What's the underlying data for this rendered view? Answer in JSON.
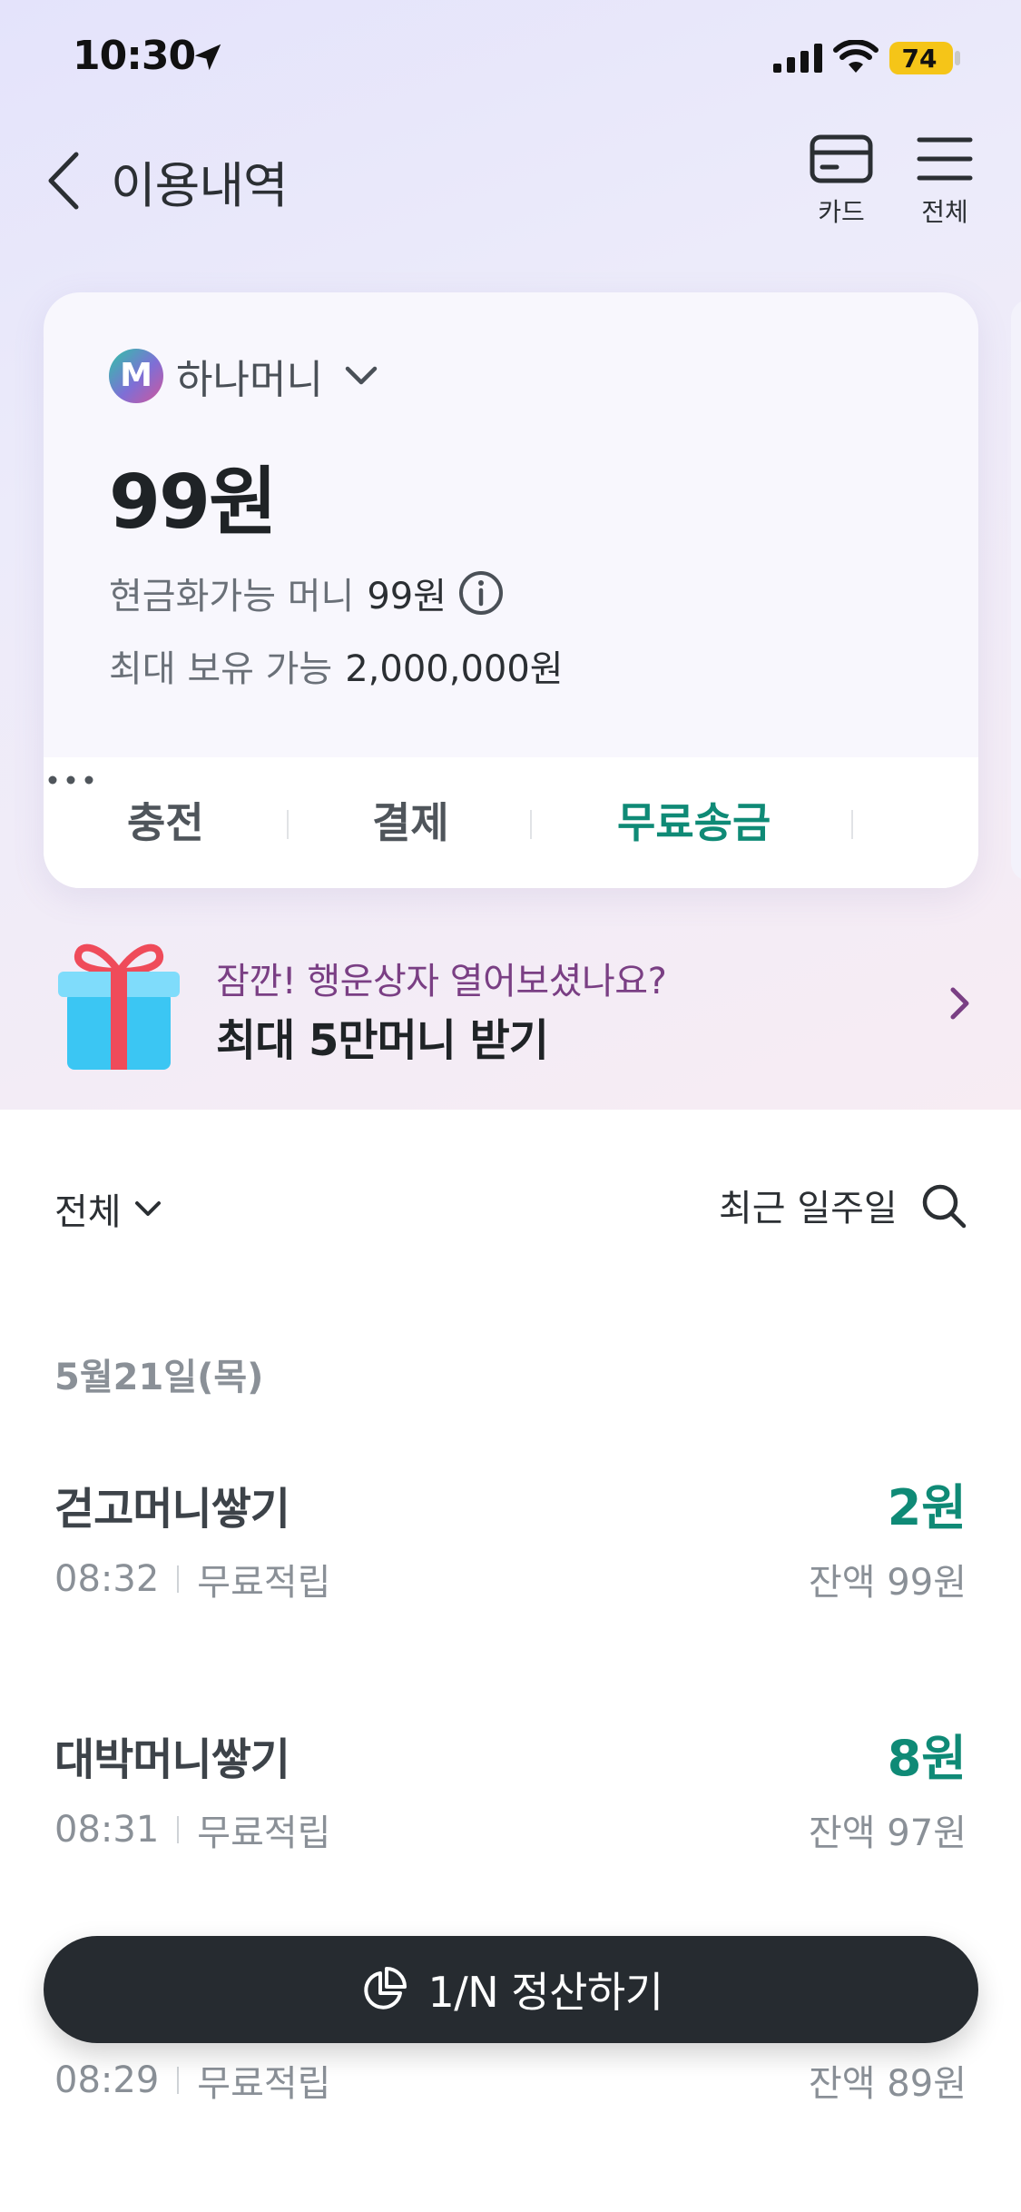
{
  "status_bar": {
    "time": "10:30",
    "battery": "74"
  },
  "header": {
    "title": "이용내역",
    "card_label": "카드",
    "menu_label": "전체"
  },
  "wallet": {
    "logo_letter": "M",
    "name": "하나머니",
    "balance": "99원",
    "cashable_label": "현금화가능 머니",
    "cashable_value": "99원",
    "max_label": "최대 보유 가능",
    "max_value": "2,000,000원",
    "actions": {
      "charge": "충전",
      "pay": "결제",
      "send": "무료송금"
    }
  },
  "promo": {
    "subtitle": "잠깐! 행운상자 열어보셨나요?",
    "title": "최대 5만머니 받기"
  },
  "filter": {
    "type": "전체",
    "period": "최근 일주일"
  },
  "date_header": "5월21일(목)",
  "transactions": [
    {
      "title": "걷고머니쌓기",
      "amount": "2원",
      "time": "08:32",
      "type": "무료적립",
      "balance": "잔액 99원"
    },
    {
      "title": "대박머니쌓기",
      "amount": "8원",
      "time": "08:31",
      "type": "무료적립",
      "balance": "잔액 97원"
    },
    {
      "title": "",
      "amount": "",
      "time": "08:29",
      "type": "무료적립",
      "balance": "잔액 89원"
    }
  ],
  "split_button": {
    "label": "1/N 정산하기"
  },
  "colors": {
    "accent_green": "#0f8a76",
    "promo_purple": "#7a3f84",
    "dark_button": "#262b30"
  }
}
